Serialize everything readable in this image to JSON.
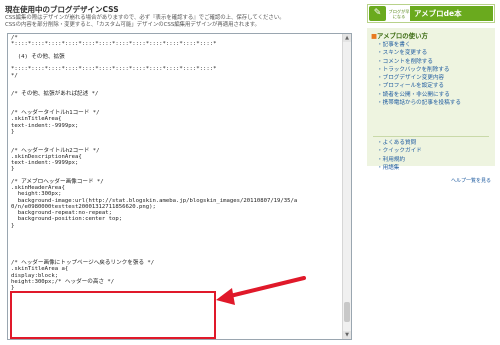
{
  "main": {
    "heading": "現在使用中のブログデザインCSS",
    "notes": [
      "CSS編集の際はデザインが崩れる場合がありますので、必ず『表示を確認する』でご確認の上、保存してください。",
      "CSSの内容を部分削除・変更すると、「カスタム可能」デザインのCSS編集用デザインが再適用されます。"
    ]
  },
  "editor": {
    "lines": [
      "/*",
      "*::::*::::*::::*::::*::::*::::*::::*::::*::::*::::*::::*::::*",
      "",
      "  (4) その他、拡張",
      "",
      "*::::*::::*::::*::::*::::*::::*::::*::::*::::*::::*::::*::::*",
      "*/",
      "",
      "",
      "/* その他、拡張があれば記述 */",
      "",
      "",
      "/* ヘッダータイトルh1コード */",
      ".skinTitleArea{",
      "text-indent:-9999px;",
      "}",
      "",
      "",
      "/* ヘッダータイトルh2コード */",
      ".skinDescriptionArea{",
      "text-indent:-9999px;",
      "}",
      "",
      "/* アメブロヘッダー画像コード */",
      ".skinHeaderArea{",
      "  height:300px;",
      "  background-image:url(http://stat.blogskin.ameba.jp/blogskin_images/20110807/19/35/a",
      "0/n/e0980000testtest20001312711856620.png);",
      "  background-repeat:no-repeat;",
      "  background-position:center top;",
      "}",
      "",
      "",
      "",
      "",
      "",
      "/* ヘッダー画像にトップページへ戻るリンクを張る */",
      ".skinTitleArea a{",
      "display:block;",
      "height:300px;/* ヘッダーの高さ */",
      "}"
    ],
    "scroll_up": "▲",
    "scroll_down": "▼"
  },
  "sidebar": {
    "logo_badge": "✎",
    "logo_tag": "ブログが早になる",
    "logo_text": "アメブロde本",
    "panel_title": "アメブロの使い方",
    "links": [
      "記事を書く",
      "スキンを変更する",
      "コメントを削除する",
      "トラックバックを削除する",
      "ブログデザイン変更内容",
      "プロフィールを設定する",
      "読者を公開・非公開にする",
      "携帯電話からの記事を投稿する"
    ],
    "links2": [
      "よくある質問",
      "クイックガイド",
      "利用規約",
      "用語集"
    ],
    "help_link": "ヘルプ一覧を見る"
  },
  "colors": {
    "annotation": "#e0192a",
    "brand_green": "#6aaa1e",
    "link": "#1d5a9f"
  }
}
